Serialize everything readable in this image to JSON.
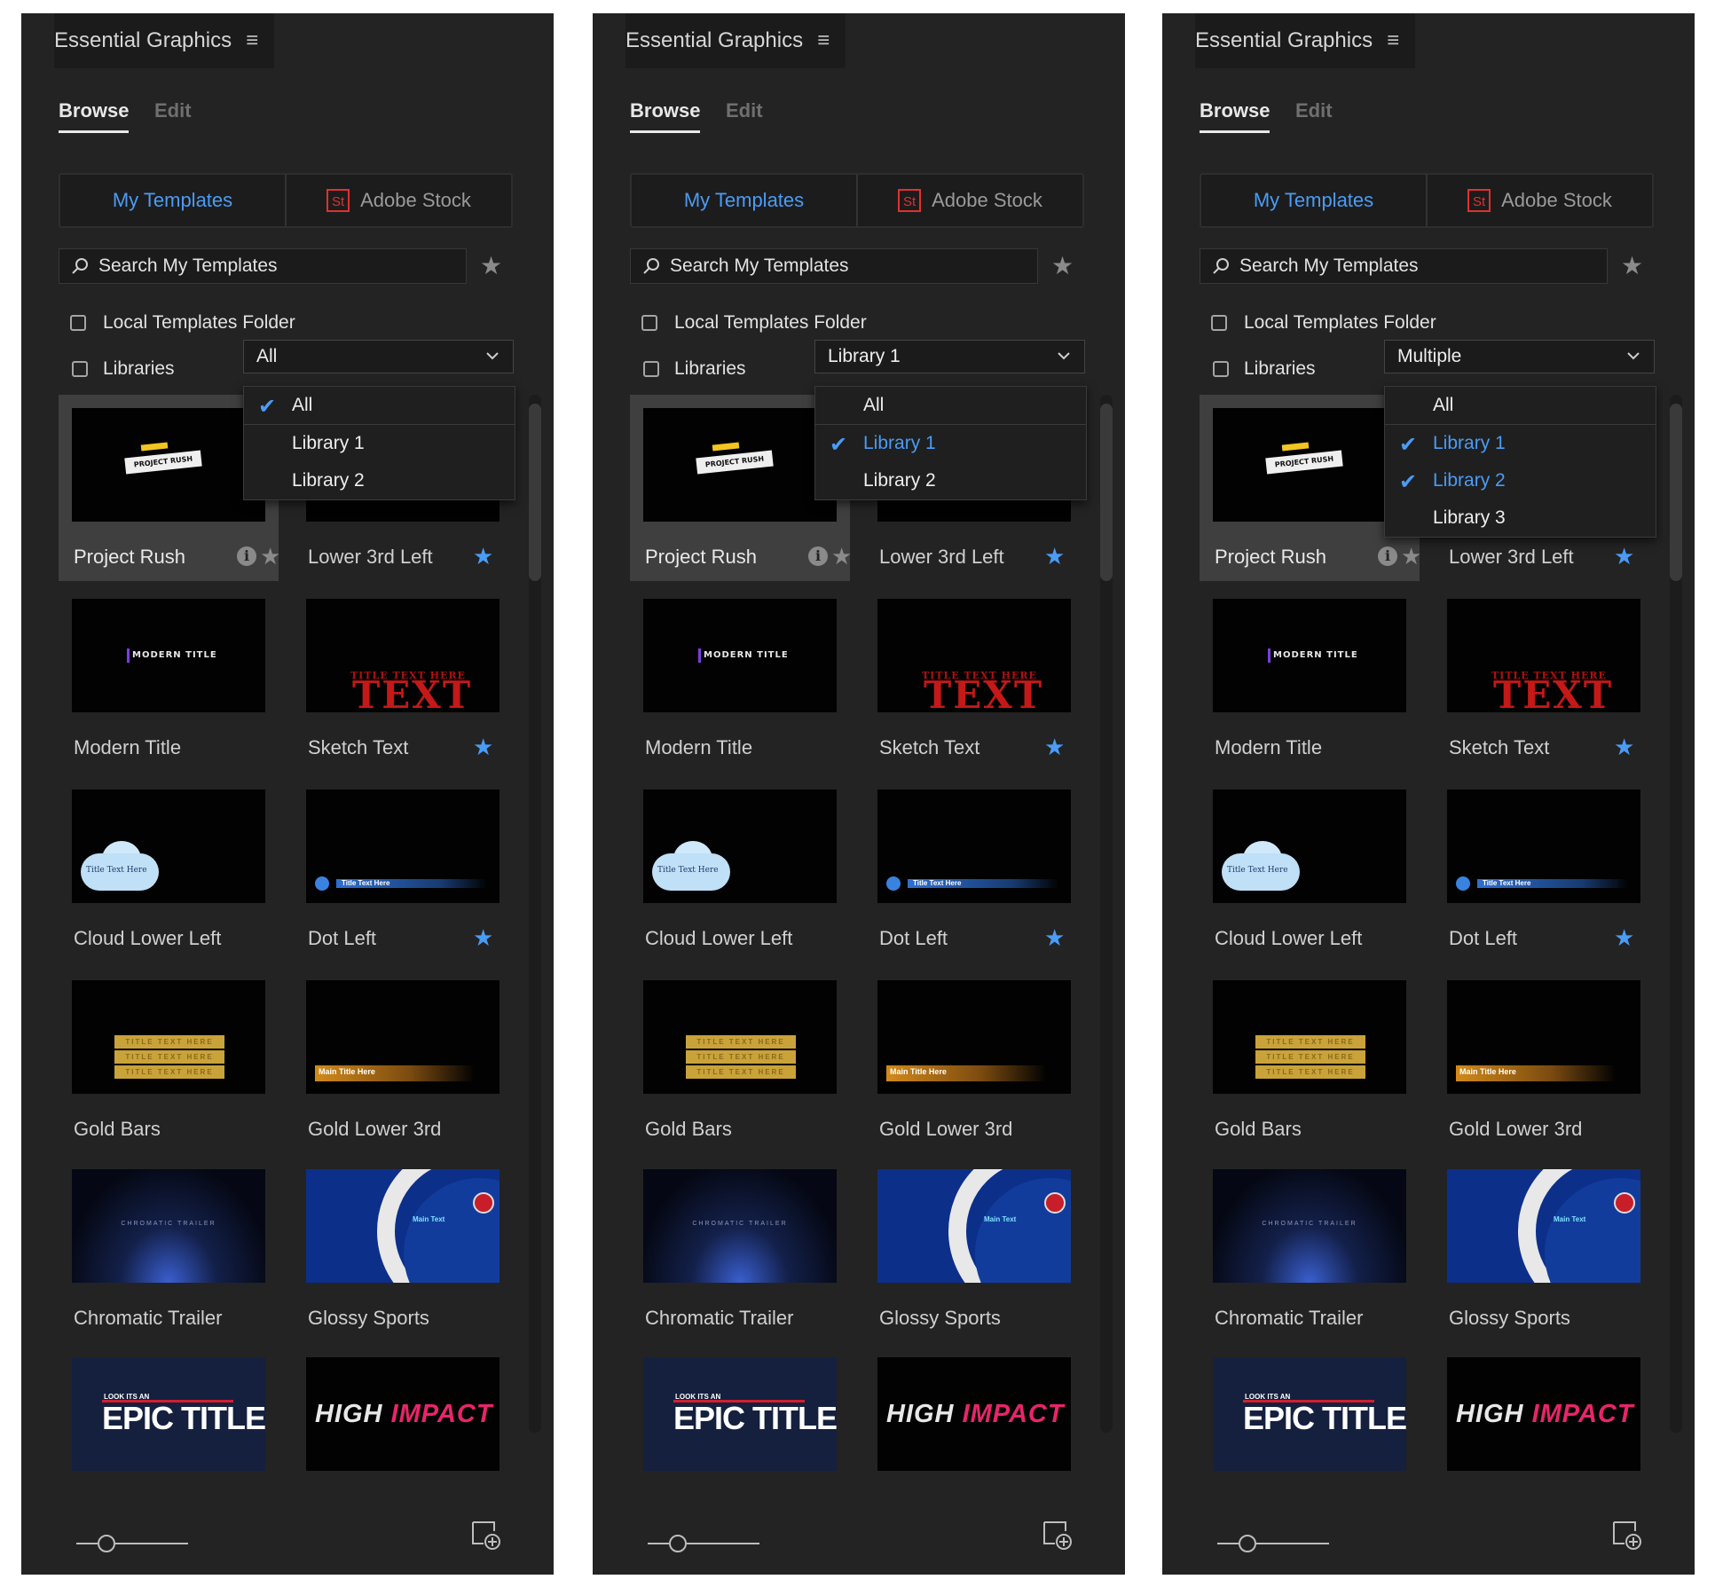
{
  "panels": [
    {
      "title": "Essential Graphics",
      "tabs": [
        "Browse",
        "Edit"
      ],
      "sources": {
        "my_templates": "My Templates",
        "adobe_stock": "Adobe Stock",
        "stock_logo": "St"
      },
      "search_placeholder": "Search My Templates",
      "local_templates_label": "Local Templates Folder",
      "libraries_label": "Libraries",
      "library_selected": "All",
      "dropdown_items": [
        {
          "label": "All",
          "checked": true
        },
        {
          "label": "Library 1",
          "checked": false
        },
        {
          "label": "Library 2",
          "checked": false
        }
      ]
    },
    {
      "title": "Essential Graphics",
      "tabs": [
        "Browse",
        "Edit"
      ],
      "sources": {
        "my_templates": "My Templates",
        "adobe_stock": "Adobe Stock",
        "stock_logo": "St"
      },
      "search_placeholder": "Search My Templates",
      "local_templates_label": "Local Templates Folder",
      "libraries_label": "Libraries",
      "library_selected": "Library 1",
      "dropdown_items": [
        {
          "label": "All",
          "checked": false
        },
        {
          "label": "Library 1",
          "checked": true
        },
        {
          "label": "Library 2",
          "checked": false
        }
      ]
    },
    {
      "title": "Essential Graphics",
      "tabs": [
        "Browse",
        "Edit"
      ],
      "sources": {
        "my_templates": "My Templates",
        "adobe_stock": "Adobe Stock",
        "stock_logo": "St"
      },
      "search_placeholder": "Search My Templates",
      "local_templates_label": "Local Templates Folder",
      "libraries_label": "Libraries",
      "library_selected": "Multiple",
      "dropdown_items": [
        {
          "label": "All",
          "checked": false
        },
        {
          "label": "Library 1",
          "checked": true
        },
        {
          "label": "Library 2",
          "checked": true
        },
        {
          "label": "Library 3",
          "checked": false
        }
      ]
    }
  ],
  "templates": [
    {
      "name": "Project Rush",
      "art": "rush",
      "favorite": false,
      "selected": true,
      "info": true,
      "art_text": "PROJECT RUSH"
    },
    {
      "name": "Lower 3rd Left",
      "art": "blank",
      "favorite": true
    },
    {
      "name": "Modern Title",
      "art": "modern",
      "favorite": false,
      "art_text": "MODERN TITLE"
    },
    {
      "name": "Sketch Text",
      "art": "sketch",
      "favorite": true,
      "art_text": "TITLE TEXT HERE",
      "art_text2": "TEXT"
    },
    {
      "name": "Cloud Lower Left",
      "art": "cloud",
      "favorite": false,
      "art_text": "Title Text Here"
    },
    {
      "name": "Dot Left",
      "art": "dot",
      "favorite": true,
      "art_text": "Title Text Here"
    },
    {
      "name": "Gold Bars",
      "art": "goldbars",
      "favorite": false,
      "art_text": "TITLE TEXT HERE"
    },
    {
      "name": "Gold Lower 3rd",
      "art": "goldlow",
      "favorite": false,
      "art_text": "Main Title Here"
    },
    {
      "name": "Chromatic Trailer",
      "art": "chrom",
      "favorite": false,
      "art_text": "CHROMATIC TRAILER"
    },
    {
      "name": "Glossy Sports",
      "art": "glossy",
      "favorite": false,
      "art_text": "Main Text"
    },
    {
      "name": "",
      "art": "epic",
      "favorite": false,
      "art_text": "LOOK ITS AN",
      "art_text2": "EPIC TITLE"
    },
    {
      "name": "",
      "art": "high",
      "favorite": false,
      "art_text": "HIGH",
      "art_text2": "IMPACT"
    }
  ],
  "icons": {
    "menu": "hamburger-icon",
    "search": "search-icon",
    "favorite": "star-icon",
    "info": "info-icon",
    "new_item": "new-item-icon",
    "zoom": "thumbnail-size-slider"
  },
  "colors": {
    "panel_bg": "#232323",
    "accent_blue": "#4a9cf5",
    "stock_red": "#e0312e",
    "selected_bg": "#3f3f3f"
  }
}
